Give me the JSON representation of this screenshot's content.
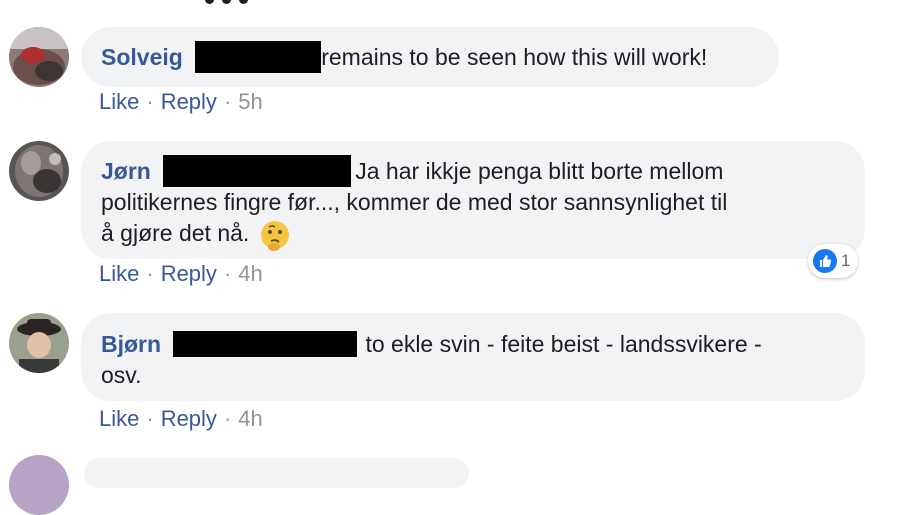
{
  "comments": [
    {
      "author": "Solveig",
      "text": "remains to be seen how this will work!",
      "actions": {
        "like": "Like",
        "reply": "Reply",
        "sep": "·",
        "time": "5h"
      }
    },
    {
      "author": "Jørn",
      "text_line1": "Ja har ikkje penga blitt borte mellom",
      "text_line2": "politikernes fingre før..., kommer de med stor sannsynlighet til",
      "text_line3": "å gjøre det nå.",
      "emoji": "thinking-face",
      "actions": {
        "like": "Like",
        "reply": "Reply",
        "sep": "·",
        "time": "4h"
      },
      "reaction": {
        "type": "like",
        "count": "1",
        "color": "#1877f2"
      }
    },
    {
      "author": "Bjørn",
      "text_line1": "to ekle svin - feite beist - landssvikere -",
      "text_line2": "osv.",
      "actions": {
        "like": "Like",
        "reply": "Reply",
        "sep": "·",
        "time": "4h"
      }
    }
  ],
  "colors": {
    "bubble": "#f2f3f5",
    "author": "#385898",
    "meta": "#90949c",
    "text": "#1c1e21"
  }
}
